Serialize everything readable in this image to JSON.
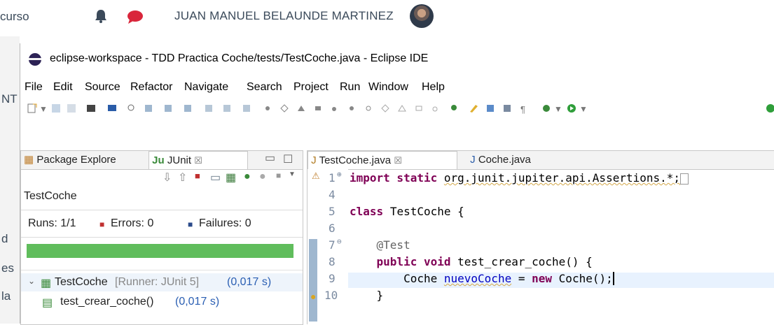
{
  "web": {
    "curso": "curso",
    "user_name": "JUAN MANUEL BELAUNDE MARTINEZ",
    "left_chars": [
      "NT",
      "d",
      "es",
      "la"
    ]
  },
  "window": {
    "title": "eclipse-workspace - TDD Practica Coche/tests/TestCoche.java - Eclipse IDE"
  },
  "menu": [
    "File",
    "Edit",
    "Source",
    "Refactor",
    "Navigate",
    "Search",
    "Project",
    "Run",
    "Window",
    "Help"
  ],
  "left_panel": {
    "tabs": [
      {
        "label": "Package Explore"
      },
      {
        "label": "JUnit",
        "close": "☒"
      }
    ],
    "test_name": "TestCoche",
    "runs_label": "Runs: 1/1",
    "errors_label": "Errors: 0",
    "failures_label": "Failures: 0",
    "progress_fraction": 1.0,
    "progress_color": "#60bd5c",
    "tree": [
      {
        "name": "TestCoche",
        "detail": "[Runner: JUnit 5]",
        "time": "(0,017 s)"
      },
      {
        "name": "test_crear_coche()",
        "time": "(0,017 s)"
      }
    ]
  },
  "editor": {
    "tabs": [
      {
        "label": "TestCoche.java",
        "close": "☒"
      },
      {
        "label": "Coche.java"
      }
    ],
    "lines": [
      {
        "n": "1",
        "fold": "⊕"
      },
      {
        "n": "4"
      },
      {
        "n": "5"
      },
      {
        "n": "6"
      },
      {
        "n": "7",
        "fold": "⊖"
      },
      {
        "n": "8"
      },
      {
        "n": "9"
      },
      {
        "n": "10"
      }
    ],
    "code": {
      "l1_kw": "import static",
      "l1_rest": "org.junit.jupiter.api.Assertions.*;",
      "l5_kw": "class",
      "l5_rest": "TestCoche {",
      "l7": "@Test",
      "l8_kw": "public void",
      "l8_rest": "test_crear_coche() {",
      "l9_a": "Coche",
      "l9_var": "nuevoCoche",
      "l9_b": "=",
      "l9_kw": "new",
      "l9_c": "Coche();",
      "l10": "}"
    }
  }
}
